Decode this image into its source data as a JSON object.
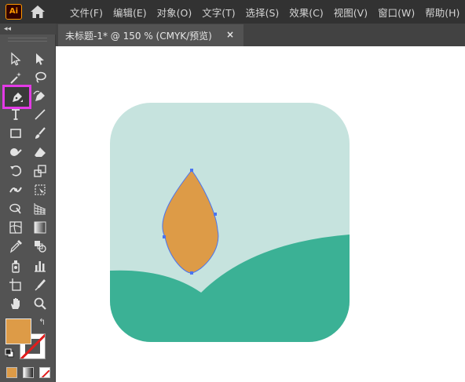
{
  "app": {
    "logo_text": "Ai",
    "home_icon": "home-icon"
  },
  "menu": {
    "items": [
      "文件(F)",
      "编辑(E)",
      "对象(O)",
      "文字(T)",
      "选择(S)",
      "效果(C)",
      "视图(V)",
      "窗口(W)",
      "帮助(H)"
    ]
  },
  "toolbar": {
    "collapse_label": "◂◂",
    "tools": [
      [
        "selection-tool-icon",
        "direct-selection-tool-icon"
      ],
      [
        "magic-wand-tool-icon",
        "lasso-tool-icon"
      ],
      [
        "pen-tool-icon",
        "curvature-tool-icon"
      ],
      [
        "type-tool-icon",
        "line-segment-tool-icon"
      ],
      [
        "rectangle-tool-icon",
        "paintbrush-tool-icon"
      ],
      [
        "shaper-tool-icon",
        "eraser-tool-icon"
      ],
      [
        "rotate-tool-icon",
        "scale-tool-icon"
      ],
      [
        "width-tool-icon",
        "free-transform-tool-icon"
      ],
      [
        "shape-builder-tool-icon",
        "perspective-grid-tool-icon"
      ],
      [
        "mesh-tool-icon",
        "gradient-tool-icon"
      ],
      [
        "eyedropper-tool-icon",
        "blend-tool-icon"
      ],
      [
        "symbol-sprayer-tool-icon",
        "column-graph-tool-icon"
      ],
      [
        "artboard-tool-icon",
        "slice-tool-icon"
      ],
      [
        "hand-tool-icon",
        "zoom-tool-icon"
      ]
    ],
    "selected_tool": "pen-tool-icon",
    "fill_color": "#dd9b47",
    "stroke_color": "none",
    "swap_label": "↰"
  },
  "document": {
    "tab_title": "未标题-1* @ 150 % (CMYK/预览)",
    "close_label": "×"
  },
  "artwork": {
    "background_color": "#c6e3de",
    "hill_color": "#3bb195",
    "leaf_color": "#dd9b47",
    "anchor_color": "#4a74f0"
  },
  "colors": {
    "highlight": "#e33ae6",
    "menubar_bg": "#323232",
    "panel_bg": "#535353"
  }
}
